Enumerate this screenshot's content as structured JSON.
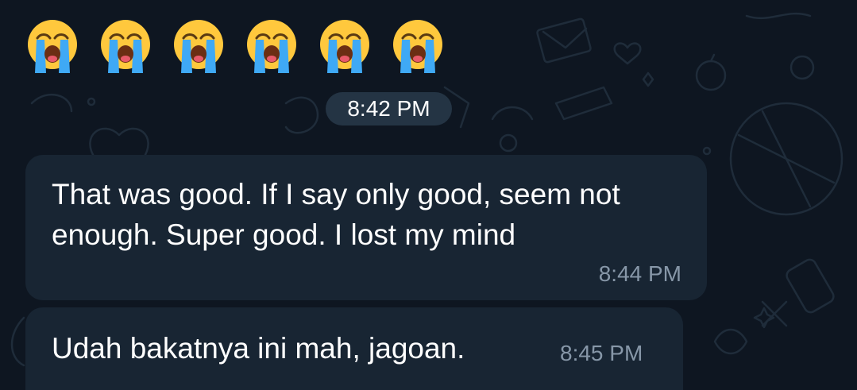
{
  "emojis": [
    {
      "icon": "loudly-crying-face-emoji"
    },
    {
      "icon": "loudly-crying-face-emoji"
    },
    {
      "icon": "loudly-crying-face-emoji"
    },
    {
      "icon": "loudly-crying-face-emoji"
    },
    {
      "icon": "loudly-crying-face-emoji"
    },
    {
      "icon": "loudly-crying-face-emoji"
    }
  ],
  "emoji_message_time": "8:42 PM",
  "messages": [
    {
      "text": "That was good. If I say only good, seem not enough. Super good. I lost my mind",
      "time": "8:44 PM"
    },
    {
      "text": "Udah bakatnya ini mah, jagoan.",
      "time": "8:45 PM"
    }
  ],
  "colors": {
    "background": "#0e1621",
    "bubble": "#182533",
    "text": "#ffffff",
    "time": "#8797a8",
    "pill": "#283a4a"
  }
}
